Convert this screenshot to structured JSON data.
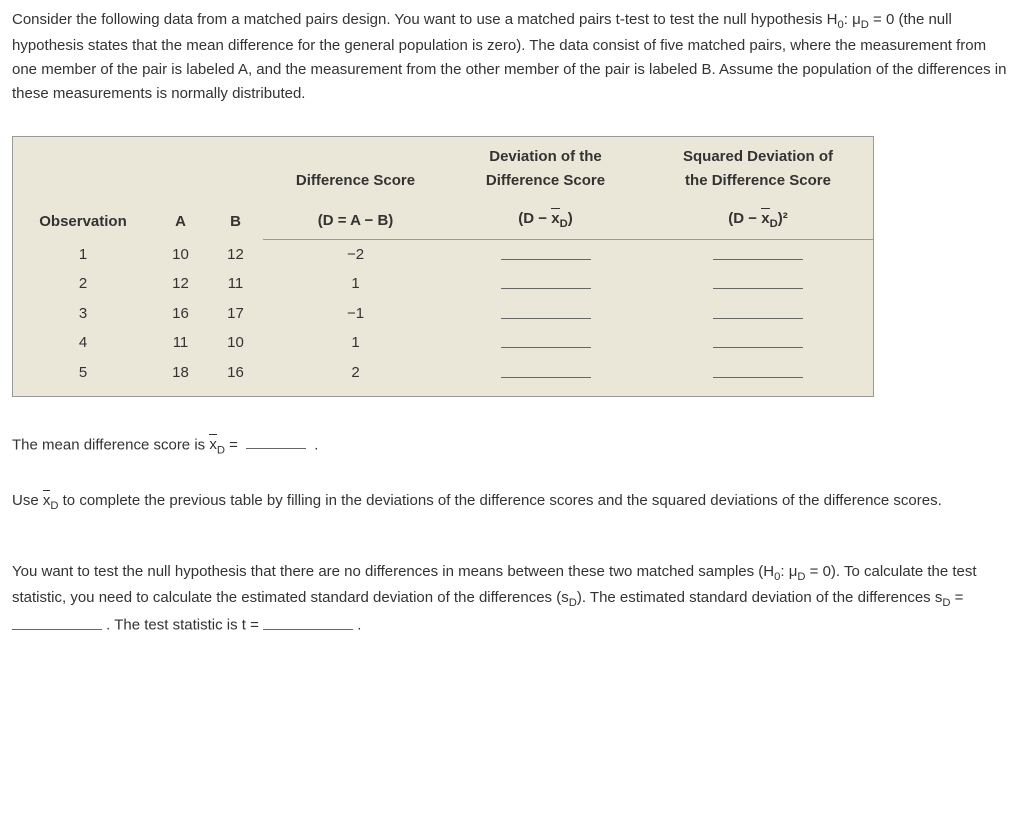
{
  "intro": "Consider the following data from a matched pairs design. You want to use a matched pairs t-test to test the null hypothesis H₀: μD = 0 (the null hypothesis states that the mean difference for the general population is zero). The data consist of five matched pairs, where the measurement from one member of the pair is labeled A, and the measurement from the other member of the pair is labeled B. Assume the population of the differences in these measurements is normally distributed.",
  "table": {
    "headers": {
      "observation": "Observation",
      "a": "A",
      "b": "B",
      "diff_top": "Difference Score",
      "diff_bottom": "(D = A − B)",
      "dev_top": "Deviation of the",
      "dev_mid": "Difference Score",
      "dev_bottom_prefix": "(D − ",
      "dev_bottom_suffix": ")",
      "sq_top": "Squared Deviation of",
      "sq_mid": "the Difference Score",
      "sq_bottom_prefix": "(D − ",
      "sq_bottom_suffix": ")²"
    },
    "rows": [
      {
        "obs": "1",
        "a": "10",
        "b": "12",
        "d": "−2"
      },
      {
        "obs": "2",
        "a": "12",
        "b": "11",
        "d": "1"
      },
      {
        "obs": "3",
        "a": "16",
        "b": "17",
        "d": "−1"
      },
      {
        "obs": "4",
        "a": "11",
        "b": "10",
        "d": "1"
      },
      {
        "obs": "5",
        "a": "18",
        "b": "16",
        "d": "2"
      }
    ]
  },
  "mean_line_prefix": "The mean difference score is ",
  "mean_line_mid": " = ",
  "mean_line_suffix": " .",
  "use_line_prefix": "Use ",
  "use_line_rest": " to complete the previous table by filling in the deviations of the difference scores and the squared deviations of the difference scores.",
  "test_para_1": "You want to test the null hypothesis that there are no differences in means between these two matched samples (H₀: μD = 0). To calculate the test statistic, you need to calculate the estimated standard deviation of the differences (sD). The estimated standard deviation of the differences sD = ",
  "test_para_2": " . The test statistic is t = ",
  "test_para_3": " .",
  "chart_data": {
    "type": "table",
    "columns": [
      "Observation",
      "A",
      "B",
      "D = A − B"
    ],
    "rows": [
      [
        1,
        10,
        12,
        -2
      ],
      [
        2,
        12,
        11,
        1
      ],
      [
        3,
        16,
        17,
        -1
      ],
      [
        4,
        11,
        10,
        1
      ],
      [
        5,
        18,
        16,
        2
      ]
    ]
  }
}
